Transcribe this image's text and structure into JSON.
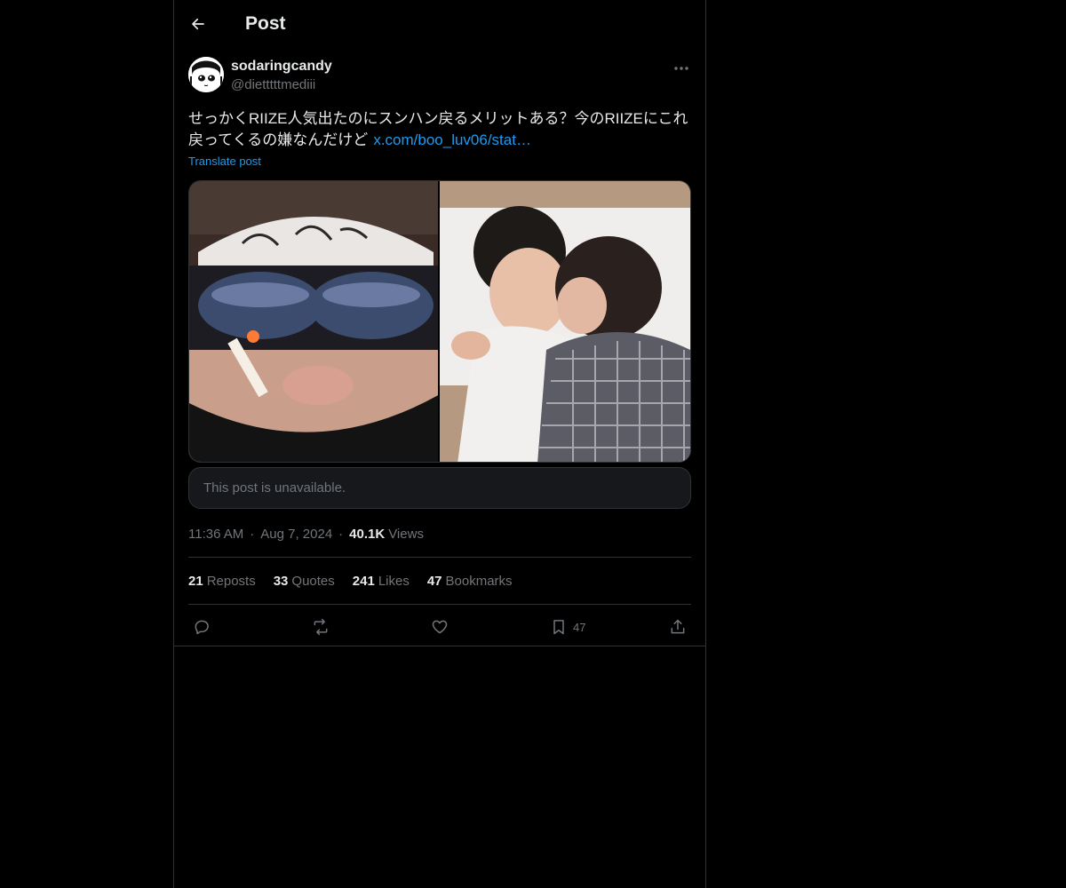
{
  "header": {
    "title": "Post"
  },
  "author": {
    "display_name": "sodaringcandy",
    "handle": "@dietttttmediii"
  },
  "post": {
    "text": "せっかくRIIZE人気出たのにスンハン戻るメリットある？今のRIIZEにこれ戻ってくるの嫌なんだけど",
    "link": "x.com/boo_luv06/stat…",
    "translate_label": "Translate post"
  },
  "quote": {
    "unavailable": "This post is unavailable."
  },
  "meta": {
    "time": "11:36 AM",
    "date": "Aug 7, 2024",
    "views_count": "40.1K",
    "views_label": "Views"
  },
  "stats": {
    "reposts": {
      "count": "21",
      "label": "Reposts"
    },
    "quotes": {
      "count": "33",
      "label": "Quotes"
    },
    "likes": {
      "count": "241",
      "label": "Likes"
    },
    "bookmarks": {
      "count": "47",
      "label": "Bookmarks"
    }
  },
  "actions": {
    "bookmark_count": "47"
  },
  "icons": [
    "back-arrow-icon",
    "more-icon",
    "reply-icon",
    "repost-icon",
    "like-icon",
    "bookmark-icon",
    "share-icon"
  ],
  "colors": {
    "accent": "#1d9bf0",
    "background": "#000000",
    "border": "#2f3336",
    "muted": "#71767b"
  }
}
